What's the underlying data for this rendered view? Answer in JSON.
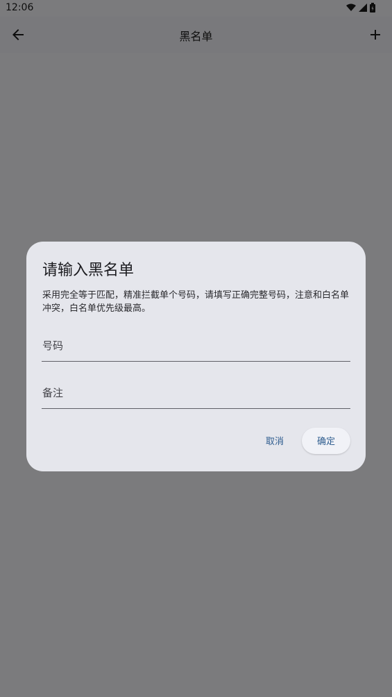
{
  "status_bar": {
    "time": "12:06",
    "icons": [
      "wifi-icon",
      "signal-icon",
      "battery-icon"
    ]
  },
  "top_bar": {
    "title": "黑名单",
    "back_icon": "arrow-back-icon",
    "add_icon": "plus-icon"
  },
  "dialog": {
    "title": "请输入黑名单",
    "description": "采用完全等于匹配，精准拦截单个号码，请填写正确完整号码，注意和白名单冲突，白名单优先级最高。",
    "phone_field": {
      "placeholder": "号码",
      "value": ""
    },
    "note_field": {
      "placeholder": "备注",
      "value": ""
    },
    "cancel_label": "取消",
    "confirm_label": "确定"
  },
  "colors": {
    "scrim": "#000000",
    "dialog_background": "#e5e6ec",
    "accent": "#2f5d8f",
    "app_background": "#f6f6fa"
  }
}
